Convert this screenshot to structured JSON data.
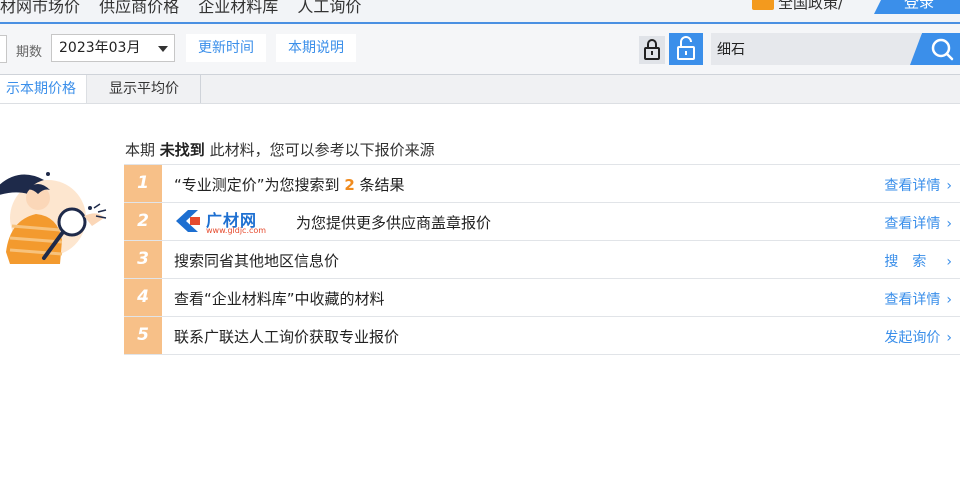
{
  "topnav": {
    "breadcrumbs": [
      "材网市场价",
      "供应商价格",
      "企业材料库",
      "人工询价"
    ],
    "region": "全国政策/",
    "login": "登录"
  },
  "filters": {
    "period_label": "期数",
    "period_value": "2023年03月",
    "update_button": "更新时间",
    "explain_button": "本期说明",
    "search_value": "细石"
  },
  "tabs": {
    "current": "示本期价格",
    "average": "显示平均价"
  },
  "notice": {
    "prefix": "本期",
    "emphasis": "未找到",
    "suffix": "此材料，您可以参考以下报价来源"
  },
  "results": [
    {
      "num": "1",
      "text_before": "“专业测定价”为您搜索到",
      "highlight": "2",
      "text_after": "条结果",
      "action": "查看详情"
    },
    {
      "num": "2",
      "logo_text": "广材网",
      "logo_domain": "www.gldjc.com",
      "text": "为您提供更多供应商盖章报价",
      "action": "查看详情"
    },
    {
      "num": "3",
      "text": "搜索同省其他地区信息价",
      "action": "搜索"
    },
    {
      "num": "4",
      "text": "查看“企业材料库”中收藏的材料",
      "action": "查看详情"
    },
    {
      "num": "5",
      "text": "联系广联达人工询价获取专业报价",
      "action": "发起询价"
    }
  ],
  "icons": [
    "flag-icon",
    "lock-icon",
    "unlock-icon",
    "search-icon",
    "chevron-right-icon",
    "illustration-woman-magnifier"
  ],
  "colors": {
    "accent": "#3b8fea",
    "number_badge": "#f7c088",
    "highlight": "#f08b1e"
  }
}
